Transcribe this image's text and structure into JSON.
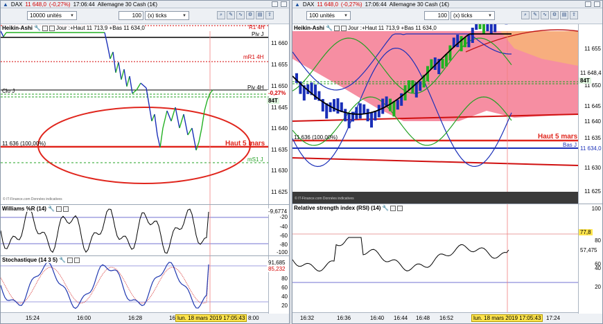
{
  "left": {
    "title": {
      "instrument": "DAX",
      "price": "11 648,0",
      "change": "(-0,27%)",
      "time": "17:06:44",
      "name": "Allemagne 30 Cash (1€)"
    },
    "toolbar": {
      "units": "10000 unités",
      "ticks_value": "100",
      "ticks_label": "(x) ticks"
    },
    "main": {
      "title_bold": "Heikin-Ashi",
      "title_info": "Jour :+Haut 11 713,9 +Bas 11 634,0",
      "y_ticks": [
        "11 660",
        "11 655",
        "11 650",
        "11 645",
        "11 640",
        "11 635",
        "11 630",
        "11 625"
      ],
      "lines": {
        "r1": "R1 4H",
        "pivj": "Piv J",
        "mr1": "mR1 4H",
        "piv4h": "Piv 4H",
        "cloj": "Clo J",
        "pct": "-0,27%",
        "t84": "84T",
        "level": "11 636 (100,00%)",
        "haut": "Haut 5 mars",
        "ms1": "mS1 J"
      },
      "watermark": "© IT-Finance.com  Données indicatives"
    },
    "williams": {
      "title": "Williams %R (14)",
      "value": "-9,6774",
      "y_ticks": [
        "-20",
        "-40",
        "-60",
        "-80",
        "-100"
      ]
    },
    "stoch": {
      "title": "Stochastique (14 3 5)",
      "v1": "91,685",
      "v2": "85,232",
      "y_ticks": [
        "80",
        "60",
        "40",
        "20"
      ]
    },
    "xaxis": {
      "ticks": [
        "15:24",
        "16:00",
        "16:28",
        "16"
      ],
      "cursor": "lun. 18 mars 2019 17:05:43",
      "end": "8:00"
    }
  },
  "right": {
    "title": {
      "instrument": "DAX",
      "price": "11 648,0",
      "change": "(-0,27%)",
      "time": "17:06:44",
      "name": "Allemagne 30 Cash (1€)"
    },
    "toolbar": {
      "units": "100 unités",
      "ticks_value": "100",
      "ticks_label": "(x) ticks"
    },
    "main": {
      "title_bold": "Heikin-Ashi",
      "title_info": "Jour :+Haut 11 713,9 +Bas 11 634,0",
      "y_ticks": [
        "11 655",
        "11 650",
        "11 645",
        "11 640",
        "11 635",
        "11 630",
        "11 625"
      ],
      "lines": {
        "price": "11 648,4",
        "t84": "84T",
        "level": "11 636 (100,00%)",
        "haut": "Haut 5 mars",
        "basj": "Bas J",
        "bas_val": "11 634,0"
      },
      "watermark": "© IT-Finance.com  Données indicatives"
    },
    "rsi": {
      "title": "Relative strength index (RSI) (14)",
      "v1": "77,8",
      "v2": "57,475",
      "y_ticks": [
        "100",
        "80",
        "60",
        "40",
        "20"
      ]
    },
    "xaxis": {
      "ticks": [
        "16:32",
        "16:36",
        "16:40",
        "16:44",
        "16:48",
        "16:52",
        "17:24"
      ],
      "cursor": "lun. 18 mars 2019 17:05:43"
    }
  },
  "colors": {
    "bull": "#22b022",
    "bear": "#1a2fb8",
    "support": "#e0261d",
    "accent": "#d40000"
  }
}
